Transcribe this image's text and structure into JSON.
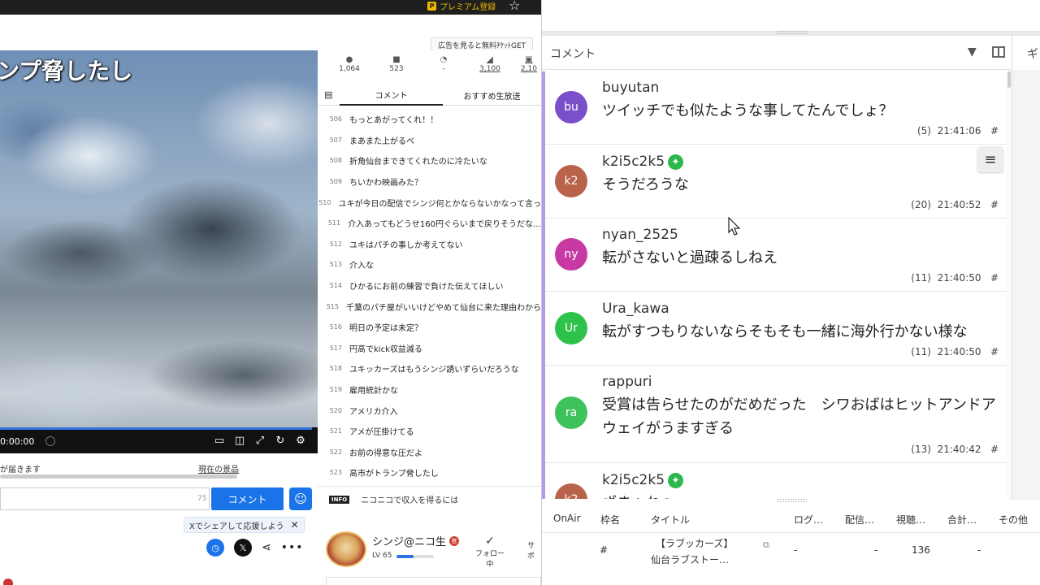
{
  "topbar": {
    "premium_label": "プレミアム登録",
    "premium_icon": "P"
  },
  "ad_tag": "広告を見ると無料ﾁｹｯﾄGET",
  "video": {
    "title": "ンプ脅したし",
    "time": "0:00:00"
  },
  "gift": {
    "label": "が届きます",
    "link": "現在の景品"
  },
  "comment_input": {
    "placeholder": "",
    "count": "75",
    "button": "コメント"
  },
  "share_tip": {
    "text": "Xでシェアして応援しよう"
  },
  "stats": [
    {
      "icon": "person-icon",
      "value": "1,064"
    },
    {
      "icon": "comment-icon",
      "value": "523"
    },
    {
      "icon": "clock-icon",
      "value": "-"
    },
    {
      "icon": "ad-icon",
      "value": "3,100"
    },
    {
      "icon": "gift-icon",
      "value": "2,10"
    }
  ],
  "tabs": [
    "コメント",
    "おすすめ生放送"
  ],
  "comments": [
    {
      "no": "506",
      "text": "もっとあがってくれ！！"
    },
    {
      "no": "507",
      "text": "まあまた上がるべ"
    },
    {
      "no": "508",
      "text": "折角仙台まできてくれたのに冷たいな"
    },
    {
      "no": "509",
      "text": "ちいかわ映画みた？"
    },
    {
      "no": "510",
      "text": "ユキが今日の配信でシンジ何とかならないかなって言っ"
    },
    {
      "no": "511",
      "text": "介入あってもどうせ160円ぐらいまで戻りそうだな…"
    },
    {
      "no": "512",
      "text": "ユキはパチの事しか考えてない"
    },
    {
      "no": "513",
      "text": "介入な"
    },
    {
      "no": "514",
      "text": "ひかるにお前の練習で負けた伝えてほしい"
    },
    {
      "no": "515",
      "text": "千葉のパチ屋がいいけどやめて仙台に来た理由わから"
    },
    {
      "no": "516",
      "text": "明日の予定は未定？"
    },
    {
      "no": "517",
      "text": "円高でkick収益減る"
    },
    {
      "no": "518",
      "text": "ユキッカーズはもうシンジ誘いずらいだろうな"
    },
    {
      "no": "519",
      "text": "雇用統計かな"
    },
    {
      "no": "520",
      "text": "アメリカ介入"
    },
    {
      "no": "521",
      "text": "アメが圧掛けてる"
    },
    {
      "no": "522",
      "text": "お前の得意な圧だよ"
    },
    {
      "no": "523",
      "text": "高市がトランプ脅したし"
    }
  ],
  "info": {
    "badge": "INFO",
    "text": "ニコニコで収入を得るには"
  },
  "streamer": {
    "name": "シンジ@ニコ生",
    "badge": "官",
    "level": "LV 65",
    "level_fraction": 0.45,
    "follow": "フォロー中",
    "support": "サポ"
  },
  "overlay": {
    "title": "コメント",
    "side_tab": "ギ",
    "items": [
      {
        "initials": "bu",
        "color": "#7b4fc9",
        "name": "buyutan",
        "verified": false,
        "text": "ツイッチでも似たような事してたんでしょ？",
        "count": "(5)",
        "time": "21:41:06",
        "hash": "#"
      },
      {
        "initials": "k2",
        "color": "#b8634a",
        "name": "k2i5c2k5",
        "verified": true,
        "text": "そうだろうな",
        "count": "(20)",
        "time": "21:40:52",
        "hash": "#"
      },
      {
        "initials": "ny",
        "color": "#c73aa3",
        "name": "nyan_2525",
        "verified": false,
        "text": "転がさないと過疎るしねえ",
        "count": "(11)",
        "time": "21:40:50",
        "hash": "#"
      },
      {
        "initials": "Ur",
        "color": "#2fc24a",
        "name": "Ura_kawa",
        "verified": false,
        "text": "転がすつもりないならそもそも一緒に海外行かない様な",
        "count": "(11)",
        "time": "21:40:50",
        "hash": "#"
      },
      {
        "initials": "ra",
        "color": "#3ec35a",
        "name": "rappuri",
        "verified": false,
        "text": "受賞は告らせたのがだめだった　シワおばはヒットアンドアウェイがうますぎる",
        "count": "(13)",
        "time": "21:40:42",
        "hash": "#"
      },
      {
        "initials": "k2",
        "color": "#b8634a",
        "name": "k2i5c2k5",
        "verified": true,
        "text": "ざまぁねぇ",
        "count": "",
        "time": "",
        "hash": ""
      }
    ],
    "table": {
      "headers": [
        "OnAir",
        "枠名",
        "タイトル",
        "ログ…",
        "配信…",
        "視聴…",
        "合計…",
        "その他"
      ],
      "row": {
        "frame": "#",
        "title_1": "【ラブッカーズ】",
        "title_2": "仙台ラブストー…",
        "log": "-",
        "stream": "-",
        "views": "136",
        "total": "-"
      }
    }
  }
}
